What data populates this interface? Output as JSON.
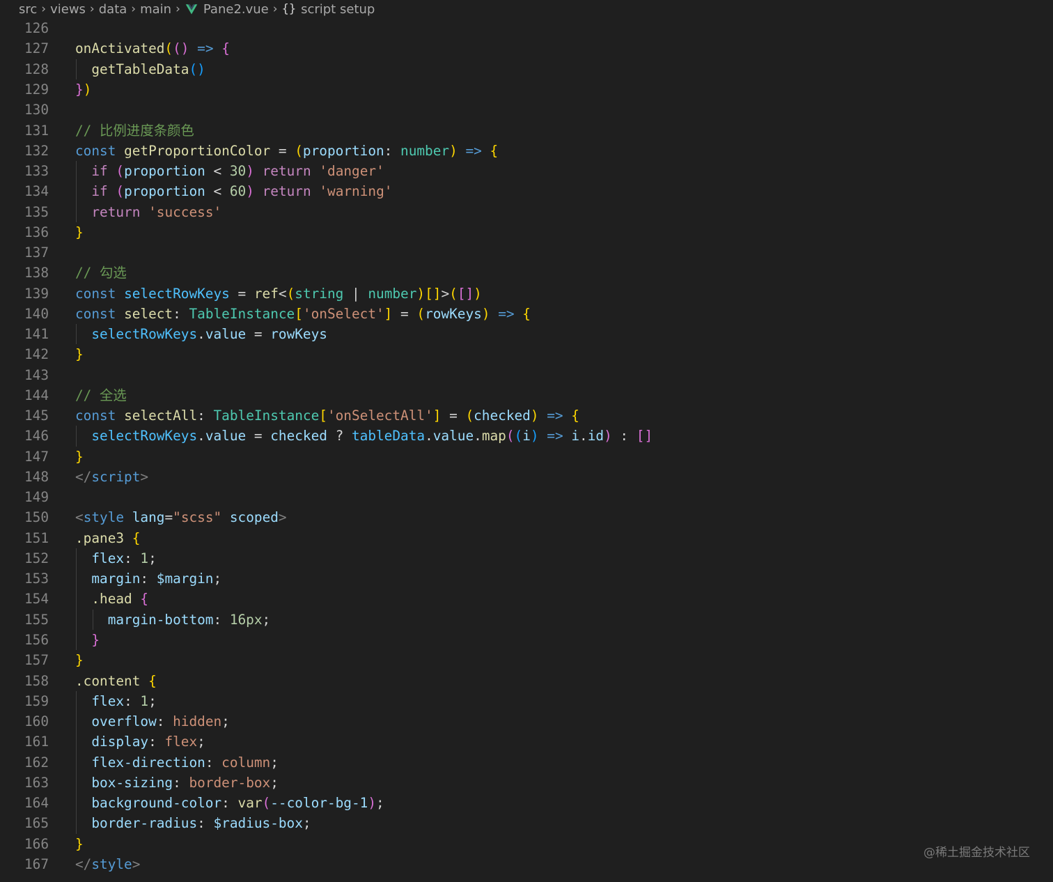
{
  "breadcrumb": {
    "items": [
      "src",
      "views",
      "data",
      "main",
      "Pane2.vue",
      "script setup"
    ],
    "file_icon": "vue-icon",
    "symbol_icon": "braces-icon"
  },
  "editor": {
    "lines": [
      {
        "n": "126",
        "indent": 0,
        "tokens": []
      },
      {
        "n": "127",
        "indent": 0,
        "tokens": [
          [
            "onActivated",
            "fn"
          ],
          [
            "(",
            "b1"
          ],
          [
            "()",
            "b2"
          ],
          [
            " ",
            "plain"
          ],
          [
            "=>",
            "kw"
          ],
          [
            " ",
            "plain"
          ],
          [
            "{",
            "b2"
          ]
        ]
      },
      {
        "n": "128",
        "indent": 1,
        "tokens": [
          [
            "  ",
            "plain"
          ],
          [
            "getTableData",
            "fn"
          ],
          [
            "()",
            "b3"
          ]
        ]
      },
      {
        "n": "129",
        "indent": 0,
        "tokens": [
          [
            "}",
            "b2"
          ],
          [
            ")",
            "b1"
          ]
        ]
      },
      {
        "n": "130",
        "indent": 0,
        "tokens": []
      },
      {
        "n": "131",
        "indent": 0,
        "tokens": [
          [
            "// 比例进度条颜色",
            "com"
          ]
        ]
      },
      {
        "n": "132",
        "indent": 0,
        "tokens": [
          [
            "const",
            "kw"
          ],
          [
            " ",
            "plain"
          ],
          [
            "getProportionColor",
            "fn"
          ],
          [
            " = ",
            "plain"
          ],
          [
            "(",
            "b1"
          ],
          [
            "proportion",
            "var"
          ],
          [
            ": ",
            "plain"
          ],
          [
            "number",
            "type"
          ],
          [
            ")",
            "b1"
          ],
          [
            " ",
            "plain"
          ],
          [
            "=>",
            "kw"
          ],
          [
            " ",
            "plain"
          ],
          [
            "{",
            "b1"
          ]
        ]
      },
      {
        "n": "133",
        "indent": 1,
        "tokens": [
          [
            "  ",
            "plain"
          ],
          [
            "if",
            "ctrl"
          ],
          [
            " ",
            "plain"
          ],
          [
            "(",
            "b2"
          ],
          [
            "proportion",
            "var"
          ],
          [
            " < ",
            "plain"
          ],
          [
            "30",
            "num"
          ],
          [
            ")",
            "b2"
          ],
          [
            " ",
            "plain"
          ],
          [
            "return",
            "ctrl"
          ],
          [
            " ",
            "plain"
          ],
          [
            "'danger'",
            "str"
          ]
        ]
      },
      {
        "n": "134",
        "indent": 1,
        "tokens": [
          [
            "  ",
            "plain"
          ],
          [
            "if",
            "ctrl"
          ],
          [
            " ",
            "plain"
          ],
          [
            "(",
            "b2"
          ],
          [
            "proportion",
            "var"
          ],
          [
            " < ",
            "plain"
          ],
          [
            "60",
            "num"
          ],
          [
            ")",
            "b2"
          ],
          [
            " ",
            "plain"
          ],
          [
            "return",
            "ctrl"
          ],
          [
            " ",
            "plain"
          ],
          [
            "'warning'",
            "str"
          ]
        ]
      },
      {
        "n": "135",
        "indent": 1,
        "tokens": [
          [
            "  ",
            "plain"
          ],
          [
            "return",
            "ctrl"
          ],
          [
            " ",
            "plain"
          ],
          [
            "'success'",
            "str"
          ]
        ]
      },
      {
        "n": "136",
        "indent": 0,
        "tokens": [
          [
            "}",
            "b1"
          ]
        ]
      },
      {
        "n": "137",
        "indent": 0,
        "tokens": []
      },
      {
        "n": "138",
        "indent": 0,
        "tokens": [
          [
            "// 勾选",
            "com"
          ]
        ]
      },
      {
        "n": "139",
        "indent": 0,
        "tokens": [
          [
            "const",
            "kw"
          ],
          [
            " ",
            "plain"
          ],
          [
            "selectRowKeys",
            "const"
          ],
          [
            " = ",
            "plain"
          ],
          [
            "ref",
            "fn"
          ],
          [
            "<",
            "plain"
          ],
          [
            "(",
            "b1"
          ],
          [
            "string",
            "type"
          ],
          [
            " | ",
            "plain"
          ],
          [
            "number",
            "type"
          ],
          [
            ")",
            "b1"
          ],
          [
            "[]",
            "b1"
          ],
          [
            ">",
            "plain"
          ],
          [
            "(",
            "b1"
          ],
          [
            "[]",
            "b2"
          ],
          [
            ")",
            "b1"
          ]
        ]
      },
      {
        "n": "140",
        "indent": 0,
        "tokens": [
          [
            "const",
            "kw"
          ],
          [
            " ",
            "plain"
          ],
          [
            "select",
            "fn"
          ],
          [
            ": ",
            "plain"
          ],
          [
            "TableInstance",
            "type"
          ],
          [
            "[",
            "b1"
          ],
          [
            "'onSelect'",
            "str"
          ],
          [
            "]",
            "b1"
          ],
          [
            " = ",
            "plain"
          ],
          [
            "(",
            "b1"
          ],
          [
            "rowKeys",
            "var"
          ],
          [
            ")",
            "b1"
          ],
          [
            " ",
            "plain"
          ],
          [
            "=>",
            "kw"
          ],
          [
            " ",
            "plain"
          ],
          [
            "{",
            "b1"
          ]
        ]
      },
      {
        "n": "141",
        "indent": 1,
        "tokens": [
          [
            "  ",
            "plain"
          ],
          [
            "selectRowKeys",
            "const"
          ],
          [
            ".",
            "plain"
          ],
          [
            "value",
            "var"
          ],
          [
            " = ",
            "plain"
          ],
          [
            "rowKeys",
            "var"
          ]
        ]
      },
      {
        "n": "142",
        "indent": 0,
        "tokens": [
          [
            "}",
            "b1"
          ]
        ]
      },
      {
        "n": "143",
        "indent": 0,
        "tokens": []
      },
      {
        "n": "144",
        "indent": 0,
        "tokens": [
          [
            "// 全选",
            "com"
          ]
        ]
      },
      {
        "n": "145",
        "indent": 0,
        "tokens": [
          [
            "const",
            "kw"
          ],
          [
            " ",
            "plain"
          ],
          [
            "selectAll",
            "fn"
          ],
          [
            ": ",
            "plain"
          ],
          [
            "TableInstance",
            "type"
          ],
          [
            "[",
            "b1"
          ],
          [
            "'onSelectAll'",
            "str"
          ],
          [
            "]",
            "b1"
          ],
          [
            " = ",
            "plain"
          ],
          [
            "(",
            "b1"
          ],
          [
            "checked",
            "var"
          ],
          [
            ")",
            "b1"
          ],
          [
            " ",
            "plain"
          ],
          [
            "=>",
            "kw"
          ],
          [
            " ",
            "plain"
          ],
          [
            "{",
            "b1"
          ]
        ]
      },
      {
        "n": "146",
        "indent": 1,
        "tokens": [
          [
            "  ",
            "plain"
          ],
          [
            "selectRowKeys",
            "const"
          ],
          [
            ".",
            "plain"
          ],
          [
            "value",
            "var"
          ],
          [
            " = ",
            "plain"
          ],
          [
            "checked",
            "var"
          ],
          [
            " ? ",
            "plain"
          ],
          [
            "tableData",
            "const"
          ],
          [
            ".",
            "plain"
          ],
          [
            "value",
            "var"
          ],
          [
            ".",
            "plain"
          ],
          [
            "map",
            "fn"
          ],
          [
            "(",
            "b2"
          ],
          [
            "(",
            "b3"
          ],
          [
            "i",
            "var"
          ],
          [
            ")",
            "b3"
          ],
          [
            " ",
            "plain"
          ],
          [
            "=>",
            "kw"
          ],
          [
            " ",
            "plain"
          ],
          [
            "i",
            "var"
          ],
          [
            ".",
            "plain"
          ],
          [
            "id",
            "var"
          ],
          [
            ")",
            "b2"
          ],
          [
            " : ",
            "plain"
          ],
          [
            "[]",
            "b2"
          ]
        ]
      },
      {
        "n": "147",
        "indent": 0,
        "tokens": [
          [
            "}",
            "b1"
          ]
        ]
      },
      {
        "n": "148",
        "indent": 0,
        "tokens": [
          [
            "</",
            "punc"
          ],
          [
            "script",
            "tag"
          ],
          [
            ">",
            "punc"
          ]
        ]
      },
      {
        "n": "149",
        "indent": 0,
        "tokens": []
      },
      {
        "n": "150",
        "indent": 0,
        "tokens": [
          [
            "<",
            "punc"
          ],
          [
            "style",
            "tag"
          ],
          [
            " ",
            "plain"
          ],
          [
            "lang",
            "attr"
          ],
          [
            "=",
            "plain"
          ],
          [
            "\"scss\"",
            "str"
          ],
          [
            " ",
            "plain"
          ],
          [
            "scoped",
            "attr"
          ],
          [
            ">",
            "punc"
          ]
        ]
      },
      {
        "n": "151",
        "indent": 0,
        "tokens": [
          [
            ".pane3",
            "fn"
          ],
          [
            " ",
            "plain"
          ],
          [
            "{",
            "b1"
          ]
        ]
      },
      {
        "n": "152",
        "indent": 1,
        "tokens": [
          [
            "  ",
            "plain"
          ],
          [
            "flex",
            "attr"
          ],
          [
            ": ",
            "plain"
          ],
          [
            "1",
            "num"
          ],
          [
            ";",
            "plain"
          ]
        ]
      },
      {
        "n": "153",
        "indent": 1,
        "tokens": [
          [
            "  ",
            "plain"
          ],
          [
            "margin",
            "attr"
          ],
          [
            ": ",
            "plain"
          ],
          [
            "$margin",
            "attr"
          ],
          [
            ";",
            "plain"
          ]
        ]
      },
      {
        "n": "154",
        "indent": 1,
        "tokens": [
          [
            "  ",
            "plain"
          ],
          [
            ".head",
            "fn"
          ],
          [
            " ",
            "plain"
          ],
          [
            "{",
            "b2"
          ]
        ]
      },
      {
        "n": "155",
        "indent": 2,
        "tokens": [
          [
            "    ",
            "plain"
          ],
          [
            "margin-bottom",
            "attr"
          ],
          [
            ": ",
            "plain"
          ],
          [
            "16px",
            "num"
          ],
          [
            ";",
            "plain"
          ]
        ]
      },
      {
        "n": "156",
        "indent": 1,
        "tokens": [
          [
            "  ",
            "plain"
          ],
          [
            "}",
            "b2"
          ]
        ]
      },
      {
        "n": "157",
        "indent": 0,
        "tokens": [
          [
            "}",
            "b1"
          ]
        ]
      },
      {
        "n": "158",
        "indent": 0,
        "tokens": [
          [
            ".content",
            "fn"
          ],
          [
            " ",
            "plain"
          ],
          [
            "{",
            "b1"
          ]
        ]
      },
      {
        "n": "159",
        "indent": 1,
        "tokens": [
          [
            "  ",
            "plain"
          ],
          [
            "flex",
            "attr"
          ],
          [
            ": ",
            "plain"
          ],
          [
            "1",
            "num"
          ],
          [
            ";",
            "plain"
          ]
        ]
      },
      {
        "n": "160",
        "indent": 1,
        "tokens": [
          [
            "  ",
            "plain"
          ],
          [
            "overflow",
            "attr"
          ],
          [
            ": ",
            "plain"
          ],
          [
            "hidden",
            "str"
          ],
          [
            ";",
            "plain"
          ]
        ]
      },
      {
        "n": "161",
        "indent": 1,
        "tokens": [
          [
            "  ",
            "plain"
          ],
          [
            "display",
            "attr"
          ],
          [
            ": ",
            "plain"
          ],
          [
            "flex",
            "str"
          ],
          [
            ";",
            "plain"
          ]
        ]
      },
      {
        "n": "162",
        "indent": 1,
        "tokens": [
          [
            "  ",
            "plain"
          ],
          [
            "flex-direction",
            "attr"
          ],
          [
            ": ",
            "plain"
          ],
          [
            "column",
            "str"
          ],
          [
            ";",
            "plain"
          ]
        ]
      },
      {
        "n": "163",
        "indent": 1,
        "tokens": [
          [
            "  ",
            "plain"
          ],
          [
            "box-sizing",
            "attr"
          ],
          [
            ": ",
            "plain"
          ],
          [
            "border-box",
            "str"
          ],
          [
            ";",
            "plain"
          ]
        ]
      },
      {
        "n": "164",
        "indent": 1,
        "tokens": [
          [
            "  ",
            "plain"
          ],
          [
            "background-color",
            "attr"
          ],
          [
            ": ",
            "plain"
          ],
          [
            "var",
            "fn"
          ],
          [
            "(",
            "b2"
          ],
          [
            "--color-bg-1",
            "attr"
          ],
          [
            ")",
            "b2"
          ],
          [
            ";",
            "plain"
          ]
        ]
      },
      {
        "n": "165",
        "indent": 1,
        "tokens": [
          [
            "  ",
            "plain"
          ],
          [
            "border-radius",
            "attr"
          ],
          [
            ": ",
            "plain"
          ],
          [
            "$radius-box",
            "attr"
          ],
          [
            ";",
            "plain"
          ]
        ]
      },
      {
        "n": "166",
        "indent": 0,
        "tokens": [
          [
            "}",
            "b1"
          ]
        ]
      },
      {
        "n": "167",
        "indent": 0,
        "tokens": [
          [
            "</",
            "punc"
          ],
          [
            "style",
            "tag"
          ],
          [
            ">",
            "punc"
          ]
        ]
      }
    ]
  },
  "watermark": "@稀土掘金技术社区",
  "colors": {
    "background": "#1f1f1f",
    "line_number": "#858585",
    "vue_green": "#41b883"
  }
}
